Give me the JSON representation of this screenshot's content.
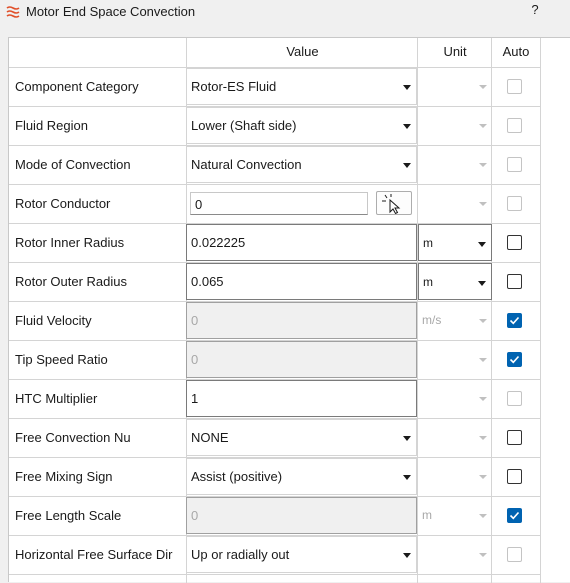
{
  "window": {
    "title": "Motor End Space Convection",
    "help": "?"
  },
  "columns": {
    "value": "Value",
    "unit": "Unit",
    "auto": "Auto"
  },
  "rows": [
    {
      "label": "Component Category",
      "value": "Rotor-ES Fluid",
      "kind": "dropdown",
      "unit": "",
      "unit_state": "disabled",
      "auto": "disabled"
    },
    {
      "label": "Fluid Region",
      "value": "Lower (Shaft side)",
      "kind": "dropdown",
      "unit": "",
      "unit_state": "disabled",
      "auto": "disabled"
    },
    {
      "label": "Mode of Convection",
      "value": "Natural Convection",
      "kind": "dropdown",
      "unit": "",
      "unit_state": "disabled",
      "auto": "disabled"
    },
    {
      "label": "Rotor Conductor",
      "value": "0",
      "kind": "picker",
      "unit": "",
      "unit_state": "disabled",
      "auto": "disabled"
    },
    {
      "label": "Rotor Inner Radius",
      "value": "0.022225",
      "kind": "text",
      "unit": "m",
      "unit_state": "active",
      "auto": "unchecked"
    },
    {
      "label": "Rotor Outer Radius",
      "value": "0.065",
      "kind": "text",
      "unit": "m",
      "unit_state": "active",
      "auto": "unchecked"
    },
    {
      "label": "Fluid Velocity",
      "value": "0",
      "kind": "readonly",
      "unit": "m/s",
      "unit_state": "disabled",
      "auto": "checked"
    },
    {
      "label": "Tip Speed Ratio",
      "value": "0",
      "kind": "readonly",
      "unit": "",
      "unit_state": "disabled",
      "auto": "checked"
    },
    {
      "label": "HTC Multiplier",
      "value": "1",
      "kind": "text",
      "unit": "",
      "unit_state": "disabled",
      "auto": "disabled"
    },
    {
      "label": "Free Convection Nu",
      "value": "NONE",
      "kind": "dropdown",
      "unit": "",
      "unit_state": "disabled",
      "auto": "unchecked"
    },
    {
      "label": "Free Mixing Sign",
      "value": "Assist (positive)",
      "kind": "dropdown",
      "unit": "",
      "unit_state": "disabled",
      "auto": "unchecked"
    },
    {
      "label": "Free Length Scale",
      "value": "0",
      "kind": "readonly",
      "unit": "m",
      "unit_state": "disabled",
      "auto": "checked"
    },
    {
      "label": "Horizontal Free Surface Dir",
      "value": "Up or radially out",
      "kind": "dropdown",
      "unit": "",
      "unit_state": "disabled",
      "auto": "disabled"
    }
  ],
  "colors": {
    "accent": "#0063b1",
    "icon": "#e0502a"
  },
  "icons": {
    "app": "waves-icon",
    "picker": "cursor-select-icon"
  }
}
